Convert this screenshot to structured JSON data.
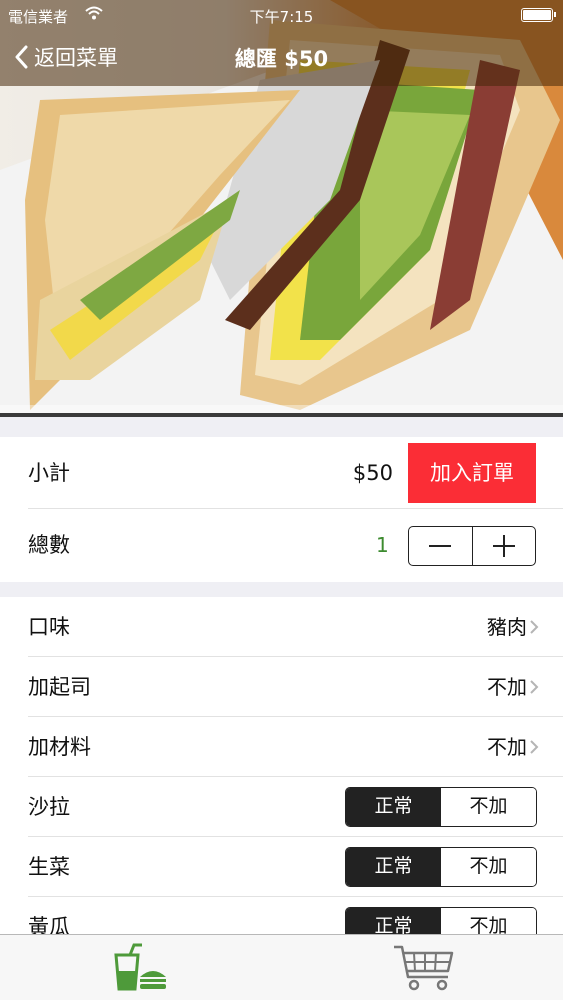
{
  "status_bar": {
    "carrier": "電信業者",
    "time": "下午7:15"
  },
  "nav": {
    "back_label": "返回菜單",
    "title": "總匯 $50"
  },
  "summary": {
    "subtotal_label": "小計",
    "subtotal_value": "$50",
    "add_button_label": "加入訂單",
    "quantity_label": "總數",
    "quantity_value": "1"
  },
  "options": {
    "rows": [
      {
        "label": "口味",
        "value": "豬肉"
      },
      {
        "label": "加起司",
        "value": "不加"
      },
      {
        "label": "加材料",
        "value": "不加"
      }
    ],
    "toggles": [
      {
        "label": "沙拉",
        "on_label": "正常",
        "off_label": "不加",
        "selected": "正常"
      },
      {
        "label": "生菜",
        "on_label": "正常",
        "off_label": "不加",
        "selected": "正常"
      },
      {
        "label": "黃瓜",
        "on_label": "正常",
        "off_label": "不加",
        "selected": "正常"
      }
    ]
  },
  "tabbar": {
    "tabs": [
      {
        "icon": "menu-food-icon",
        "active": true
      },
      {
        "icon": "shopping-cart-icon",
        "active": false
      }
    ]
  },
  "colors": {
    "accent_red": "#fb2d36",
    "quantity_green": "#3d8b2f",
    "tab_active_green": "#4e9a3a"
  }
}
